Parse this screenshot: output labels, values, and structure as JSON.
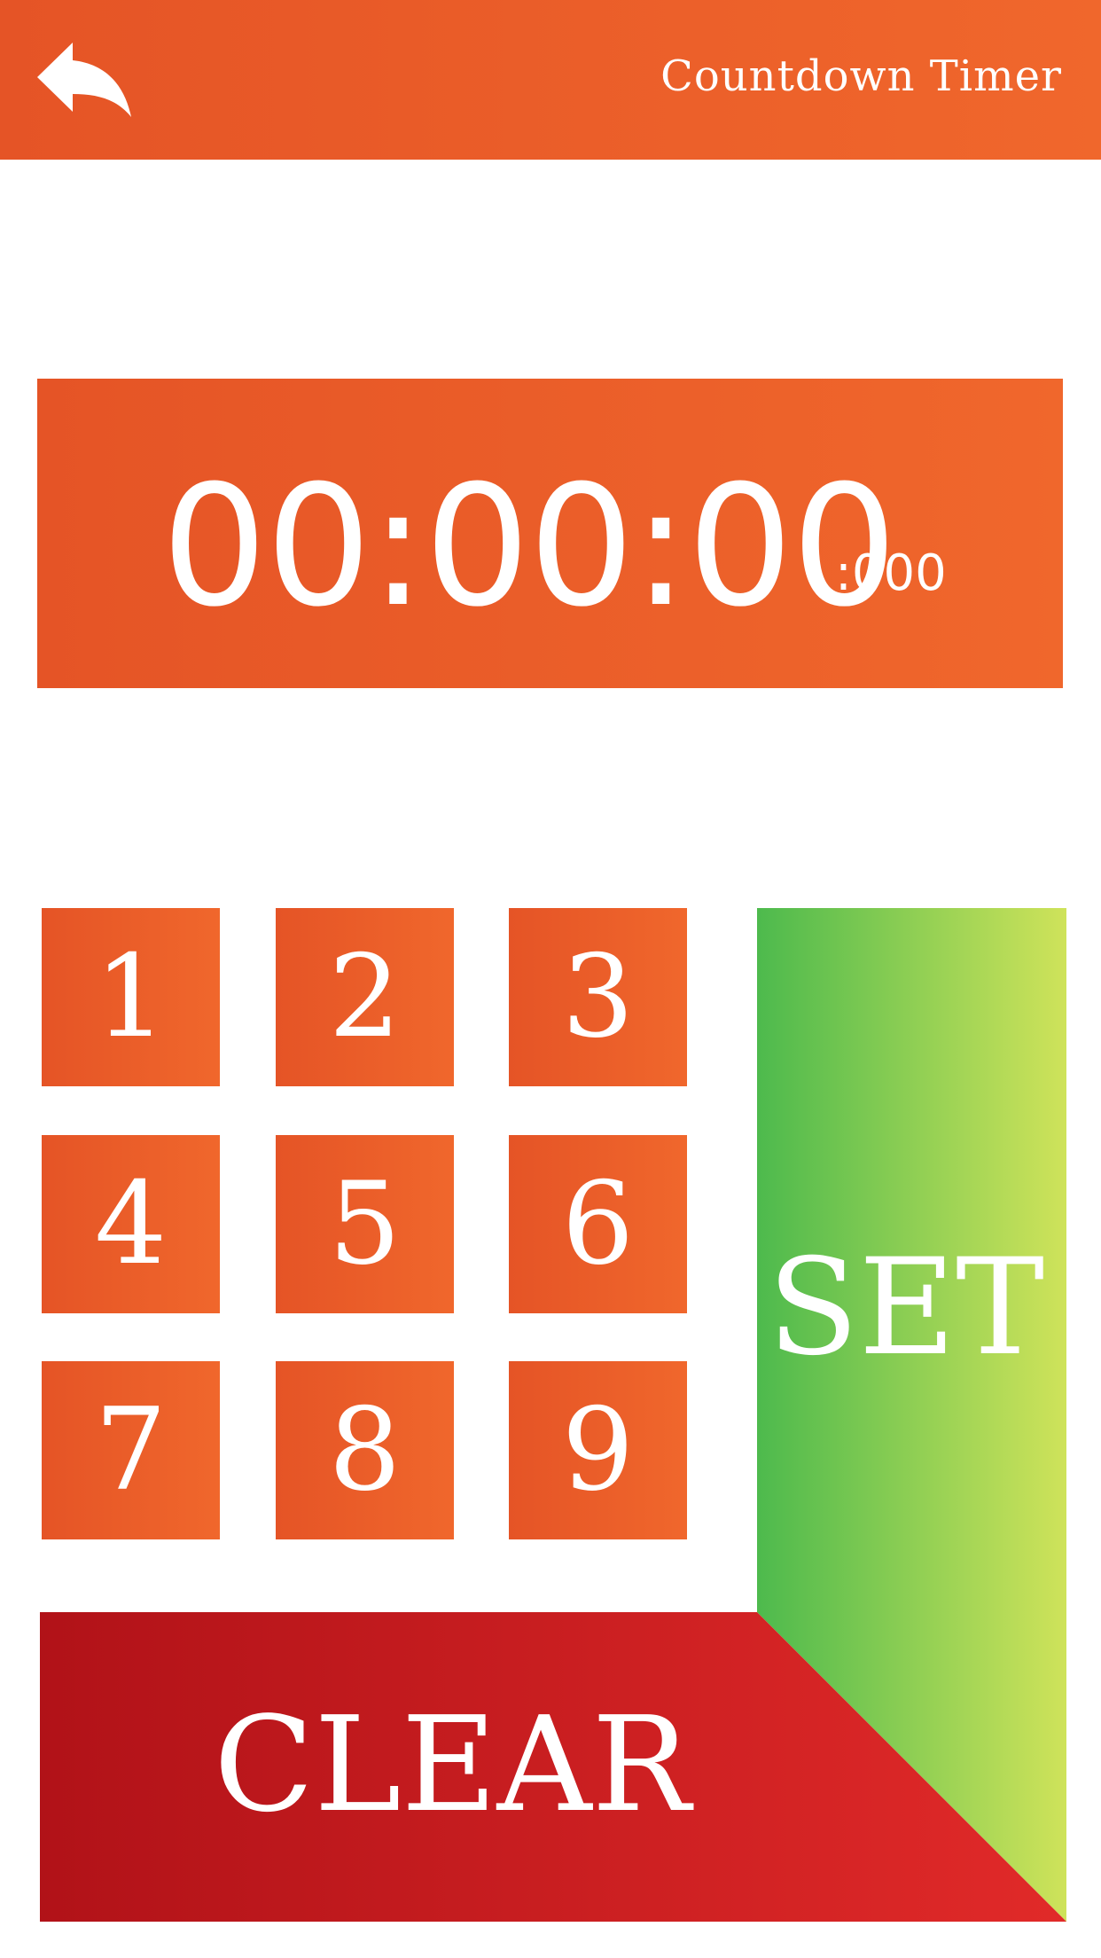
{
  "header": {
    "title": "Countdown Timer",
    "back_icon": "back-arrow-icon",
    "color_start": "#e55426",
    "color_end": "#f0672c"
  },
  "display": {
    "time": "00:00:00",
    "milliseconds": ":000"
  },
  "keypad": {
    "keys": [
      "1",
      "2",
      "3",
      "4",
      "5",
      "6",
      "7",
      "8",
      "9"
    ]
  },
  "actions": {
    "set_label": "SET",
    "clear_label": "CLEAR",
    "set_color_start": "#4dba4d",
    "set_color_end": "#cfe35a",
    "clear_color_start": "#b11218",
    "clear_color_end": "#e12a29"
  }
}
